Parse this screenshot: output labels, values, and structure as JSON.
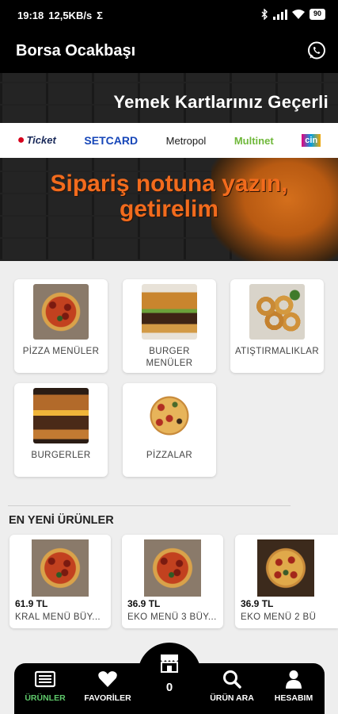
{
  "status_bar": {
    "time": "19:18",
    "speed": "12,5KB/s",
    "sigma": "Σ",
    "battery": "90"
  },
  "app": {
    "title": "Borsa Ocakbaşı",
    "whatsapp_icon": "whatsapp-icon"
  },
  "banner": {
    "headline_top": "Yemek Kartlarınız Geçerli",
    "card_brands": [
      "Ticket",
      "SETCARD",
      "Metropol",
      "Multinet",
      "cin"
    ],
    "headline_line1": "Sipariş notuna yazın,",
    "headline_line2": "getirelim",
    "accent_color": "#f26b1d"
  },
  "categories": [
    {
      "label": "PİZZA MENÜLER",
      "image": "pizza"
    },
    {
      "label": "BURGER MENÜLER",
      "image": "burger"
    },
    {
      "label": "ATIŞTIRMALIKLAR",
      "image": "onion-rings"
    },
    {
      "label": "BURGERLER",
      "image": "burger"
    },
    {
      "label": "PİZZALAR",
      "image": "pizza"
    }
  ],
  "new_products": {
    "title": "EN YENİ ÜRÜNLER",
    "items": [
      {
        "price": "61.9 TL",
        "name": "KRAL MENÜ BÜY..."
      },
      {
        "price": "36.9 TL",
        "name": "EKO MENÜ 3  BÜY..."
      },
      {
        "price": "36.9 TL",
        "name": "EKO MENÜ 2 BÜ"
      }
    ]
  },
  "bottom_nav": {
    "items": [
      {
        "label": "ÜRÜNLER",
        "icon": "list-icon",
        "active": true
      },
      {
        "label": "FAVORİLER",
        "icon": "heart-icon",
        "active": false
      },
      {
        "label": "ÜRÜN ARA",
        "icon": "search-icon",
        "active": false
      },
      {
        "label": "HESABIM",
        "icon": "user-icon",
        "active": false
      }
    ],
    "cart_count": "0",
    "cart_icon": "store-icon",
    "active_color": "#5fc96b"
  }
}
